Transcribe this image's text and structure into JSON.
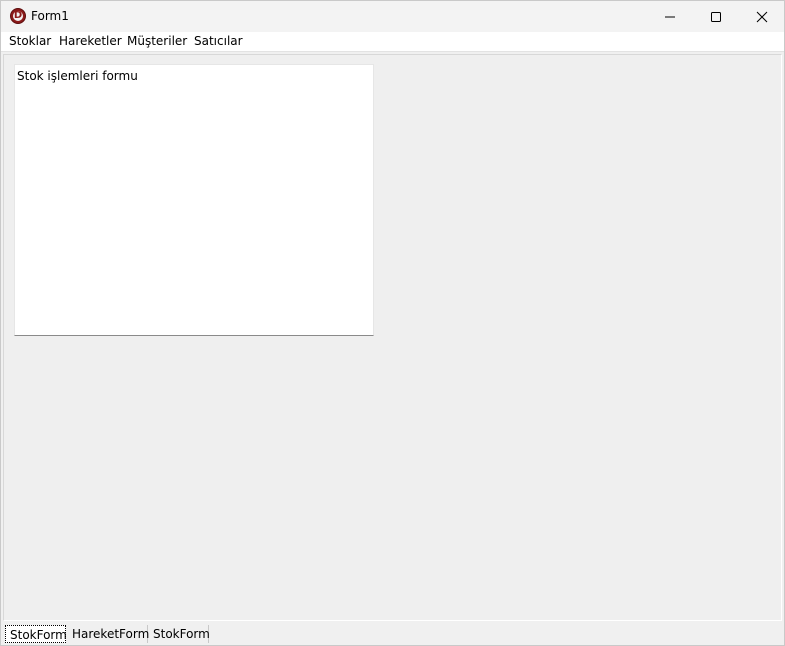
{
  "window": {
    "title": "Form1",
    "app_icon": "delphi-app-icon",
    "app_icon_letter": "D",
    "controls": [
      "minimize-icon",
      "maximize-icon",
      "close-icon"
    ]
  },
  "menubar": {
    "items": [
      {
        "label": "Stoklar"
      },
      {
        "label": "Hareketler"
      },
      {
        "label": "Müşteriler"
      },
      {
        "label": "Satıcılar"
      }
    ]
  },
  "child_form": {
    "label": "Stok işlemleri formu"
  },
  "tabs": {
    "items": [
      {
        "label": "StokForm",
        "active": true
      },
      {
        "label": "HareketForm",
        "active": false
      },
      {
        "label": "StokForm",
        "active": false
      }
    ]
  }
}
